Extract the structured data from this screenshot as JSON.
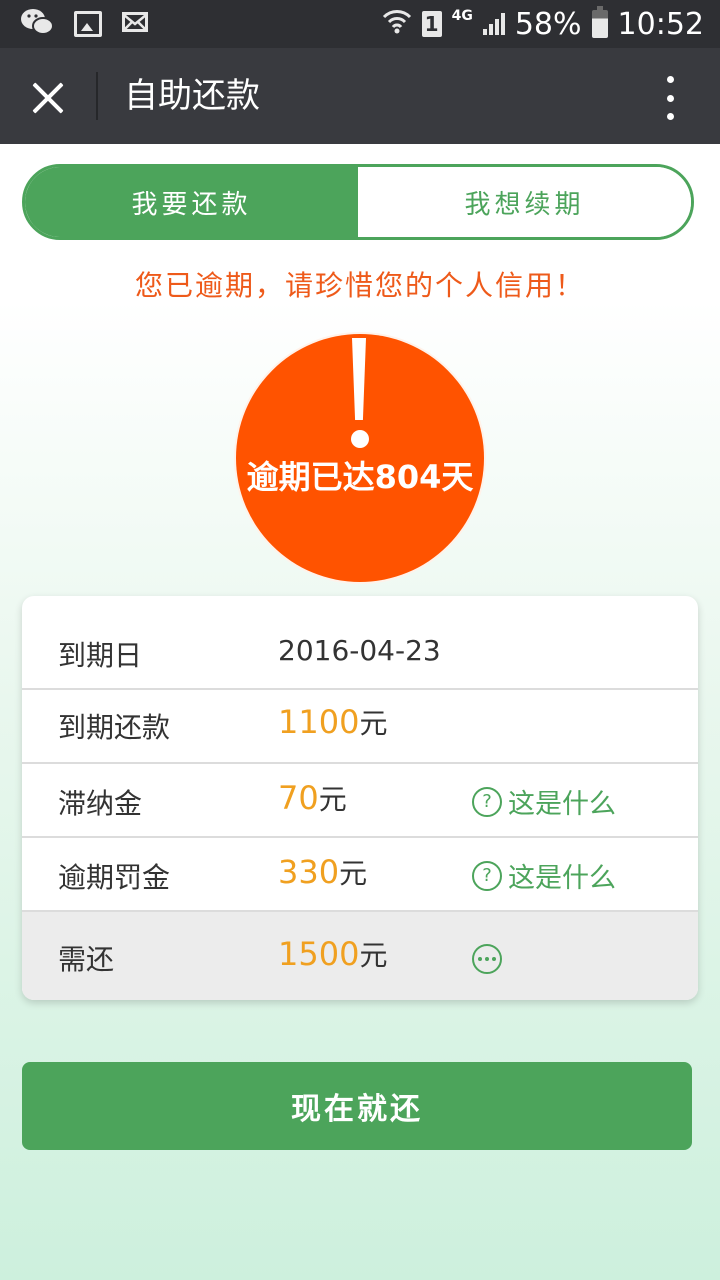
{
  "status_bar": {
    "icons": [
      "wechat-icon",
      "image-icon",
      "mail-icon",
      "wifi-icon",
      "sim-icon",
      "signal-icon",
      "battery-icon"
    ],
    "sim": "1",
    "network": "4G",
    "battery": "58%",
    "time": "10:52"
  },
  "nav": {
    "title": "自助还款"
  },
  "toggle": {
    "repay": "我要还款",
    "renew": "我想续期"
  },
  "warning": "您已逾期，请珍惜您的个人信用！",
  "overdue": "逾期已达804天",
  "details": {
    "due_date": {
      "label": "到期日",
      "value": "2016-04-23"
    },
    "due_amount": {
      "label": "到期还款",
      "amount": "1100",
      "unit": "元"
    },
    "late_fee": {
      "label": "滞纳金",
      "amount": "70",
      "unit": "元",
      "help": "这是什么"
    },
    "penalty": {
      "label": "逾期罚金",
      "amount": "330",
      "unit": "元",
      "help": "这是什么"
    },
    "total": {
      "label": "需还",
      "amount": "1500",
      "unit": "元"
    }
  },
  "pay_button": "现在就还",
  "colors": {
    "brand_green": "#4ca45b",
    "alert_orange": "#ff5300",
    "amount_yellow": "#f0a020",
    "nav_bg": "#393a3f"
  }
}
